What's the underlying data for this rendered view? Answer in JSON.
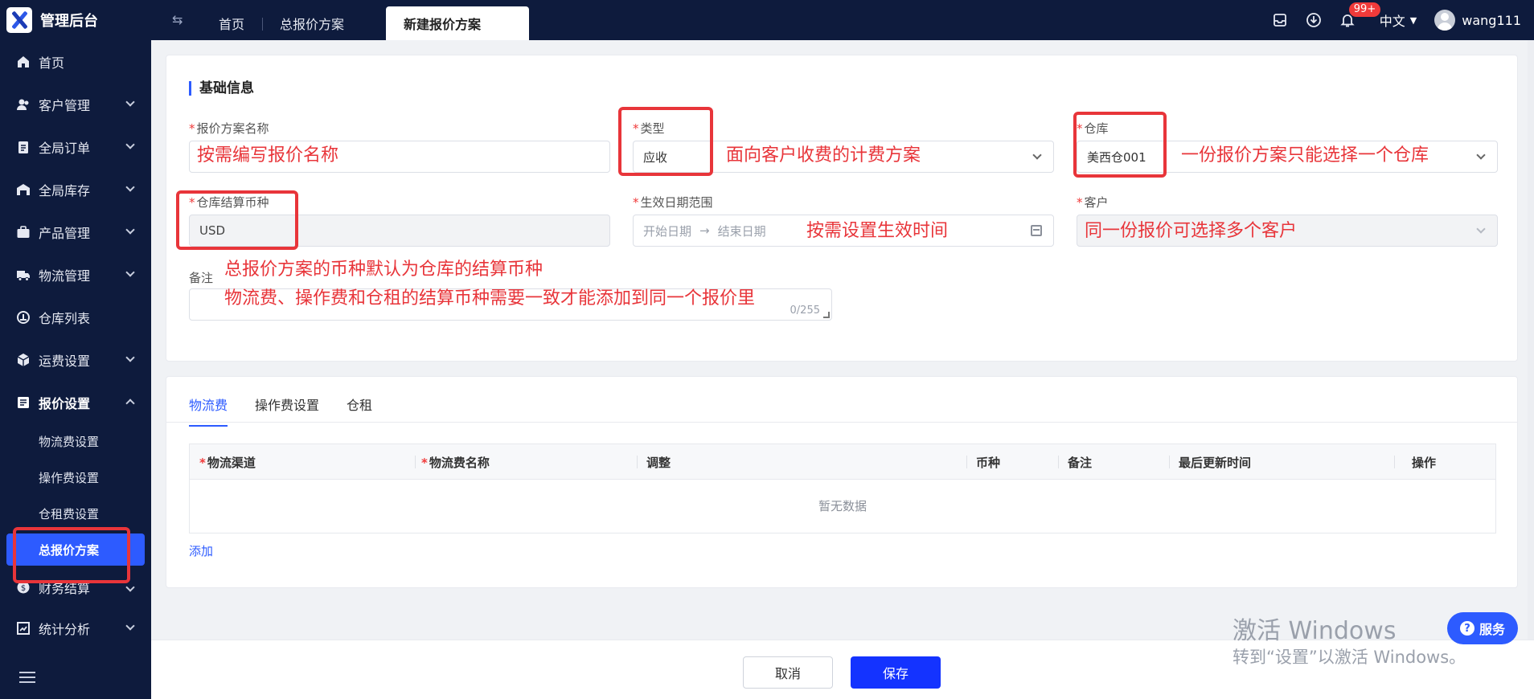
{
  "header": {
    "app_title": "管理后台",
    "tabs": [
      {
        "label": "首页"
      },
      {
        "label": "总报价方案"
      },
      {
        "label": "新建报价方案"
      }
    ],
    "notification_count": "99+",
    "language": "中文",
    "username": "wang111"
  },
  "sidebar": {
    "items": [
      {
        "label": "首页",
        "icon": "home-icon"
      },
      {
        "label": "客户管理",
        "icon": "users-icon"
      },
      {
        "label": "全局订单",
        "icon": "clipboard-icon"
      },
      {
        "label": "全局库存",
        "icon": "warehouse-icon"
      },
      {
        "label": "产品管理",
        "icon": "briefcase-icon"
      },
      {
        "label": "物流管理",
        "icon": "truck-icon"
      },
      {
        "label": "仓库列表",
        "icon": "building-icon"
      },
      {
        "label": "运费设置",
        "icon": "package-icon"
      },
      {
        "label": "报价设置",
        "icon": "document-icon"
      },
      {
        "label": "财务结算",
        "icon": "coin-icon"
      },
      {
        "label": "统计分析",
        "icon": "chart-icon"
      }
    ],
    "sub_items": [
      {
        "label": "物流费设置"
      },
      {
        "label": "操作费设置"
      },
      {
        "label": "仓租费设置"
      },
      {
        "label": "总报价方案"
      }
    ]
  },
  "form": {
    "section_title": "基础信息",
    "name": {
      "label": "报价方案名称",
      "value": ""
    },
    "type": {
      "label": "类型",
      "value": "应收"
    },
    "warehouse": {
      "label": "仓库",
      "value": "美西仓001"
    },
    "currency": {
      "label": "仓库结算币种",
      "value": "USD"
    },
    "date_range": {
      "label": "生效日期范围",
      "start_placeholder": "开始日期",
      "end_placeholder": "结束日期"
    },
    "customer": {
      "label": "客户",
      "value": ""
    },
    "remark": {
      "label": "备注",
      "counter": "0/255"
    }
  },
  "annotations": {
    "name_hint": "按需编写报价名称",
    "type_hint": "面向客户收费的计费方案",
    "warehouse_hint": "一份报价方案只能选择一个仓库",
    "date_hint": "按需设置生效时间",
    "customer_hint": "同一份报价可选择多个客户",
    "currency_hint_1": "总报价方案的币种默认为仓库的结算币种",
    "currency_hint_2": "物流费、操作费和仓租的结算币种需要一致才能添加到同一个报价里"
  },
  "fee_tabs": [
    {
      "label": "物流费"
    },
    {
      "label": "操作费设置"
    },
    {
      "label": "仓租"
    }
  ],
  "table": {
    "columns": [
      {
        "label": "物流渠道",
        "required": true
      },
      {
        "label": "物流费名称",
        "required": true
      },
      {
        "label": "调整",
        "required": false
      },
      {
        "label": "币种",
        "required": false
      },
      {
        "label": "备注",
        "required": false
      },
      {
        "label": "最后更新时间",
        "required": false
      },
      {
        "label": "操作",
        "required": false
      }
    ],
    "empty_text": "暂无数据",
    "add_label": "添加"
  },
  "footer": {
    "cancel_label": "取消",
    "save_label": "保存"
  },
  "overlay": {
    "windows_line1": "激活 Windows",
    "windows_line2": "转到“设置”以激活 Windows。",
    "service_label": "服务"
  },
  "colors": {
    "accent": "#2d5bff",
    "sidebar_bg": "#0e1b3d",
    "annotation_red": "#e8353a",
    "required_red": "#f03a3a"
  }
}
